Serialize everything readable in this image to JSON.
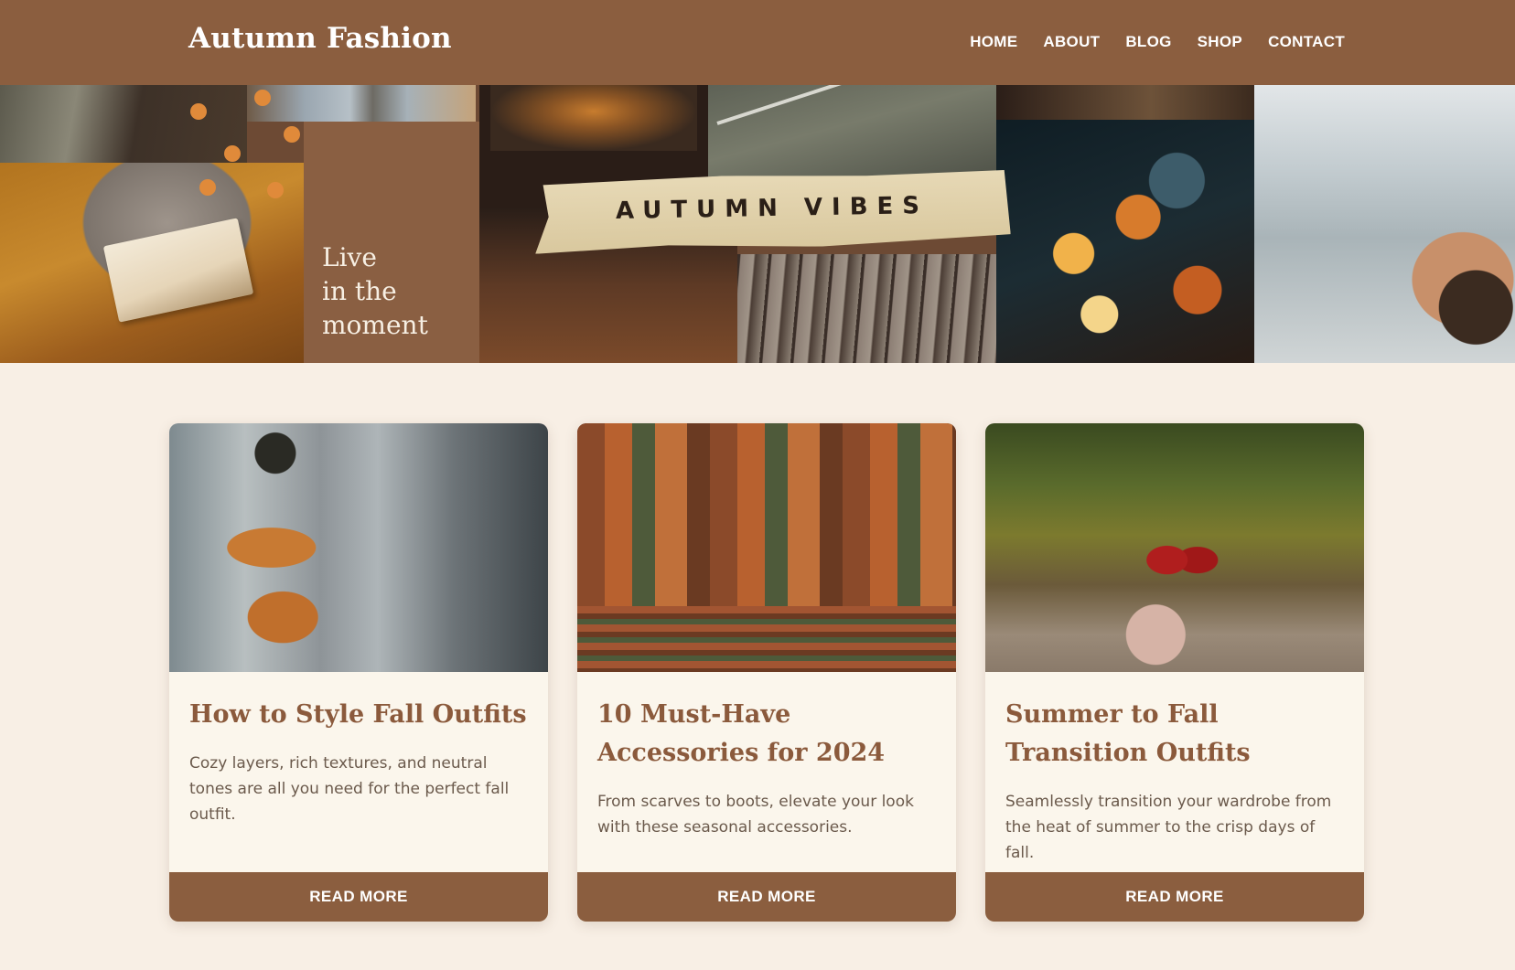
{
  "header": {
    "logo": "Autumn Fashion",
    "nav": [
      "HOME",
      "ABOUT",
      "BLOG",
      "SHOP",
      "CONTACT"
    ]
  },
  "hero": {
    "quote_lines": [
      "Live",
      "in the",
      "moment"
    ],
    "tape_text": "AUTUMN VIBES"
  },
  "cards": [
    {
      "title": "How to Style Fall Outfits",
      "excerpt": "Cozy layers, rich textures, and neutral tones are all you need for the perfect fall outfit.",
      "button": "READ MORE"
    },
    {
      "title": "10 Must-Have Accessories for 2024",
      "excerpt": "From scarves to boots, elevate your look with these seasonal accessories.",
      "button": "READ MORE"
    },
    {
      "title": "Summer to Fall Transition Outfits",
      "excerpt": "Seamlessly transition your wardrobe from the heat of summer to the crisp days of fall.",
      "button": "READ MORE"
    }
  ],
  "colors": {
    "brand": "#8b5e3f",
    "background": "#f8efe5",
    "card": "#fbf6ec",
    "title": "#8b5a3c"
  }
}
